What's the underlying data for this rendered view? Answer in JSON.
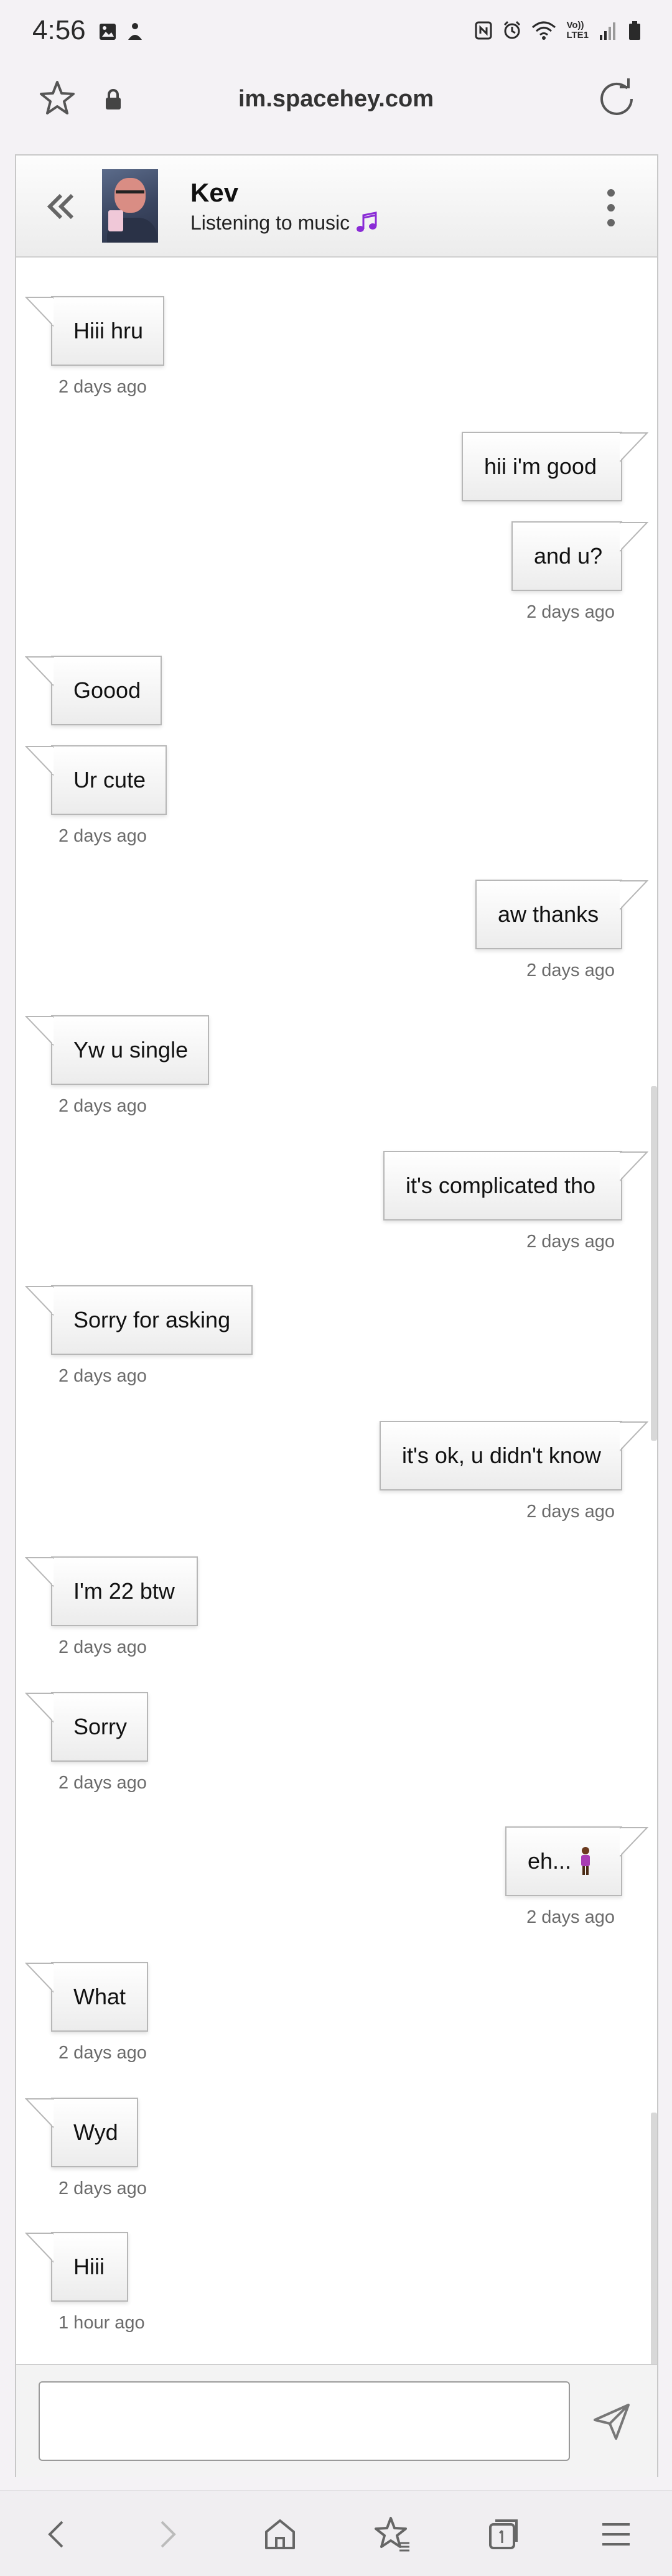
{
  "status_bar": {
    "time": "4:56",
    "network_label_top": "Vo))",
    "network_label_bottom": "LTE1"
  },
  "browser": {
    "url": "im.spacehey.com"
  },
  "chat": {
    "contact_name": "Kev",
    "contact_status": "Listening to music",
    "composer_placeholder": ""
  },
  "messages": [
    {
      "side": "in",
      "text": "Hiii hru",
      "time": "2 days ago"
    },
    {
      "side": "out",
      "text": "hii i'm good",
      "time": ""
    },
    {
      "side": "out",
      "text": "and u?",
      "time": "2 days ago"
    },
    {
      "side": "in",
      "text": "Goood",
      "time": ""
    },
    {
      "side": "in",
      "text": "Ur cute",
      "time": "2 days ago"
    },
    {
      "side": "out",
      "text": "aw thanks",
      "time": "2 days ago"
    },
    {
      "side": "in",
      "text": "Yw u single",
      "time": "2 days ago"
    },
    {
      "side": "out",
      "text": "it's complicated tho",
      "time": "2 days ago"
    },
    {
      "side": "in",
      "text": "Sorry for asking",
      "time": "2 days ago"
    },
    {
      "side": "out",
      "text": "it's ok, u didn't know",
      "time": "2 days ago"
    },
    {
      "side": "in",
      "text": "I'm 22 btw",
      "time": "2 days ago"
    },
    {
      "side": "in",
      "text": "Sorry",
      "time": "2 days ago"
    },
    {
      "side": "out",
      "text": "eh...",
      "time": "2 days ago",
      "emoji": "person-standing-emoji"
    },
    {
      "side": "in",
      "text": "What",
      "time": "2 days ago"
    },
    {
      "side": "in",
      "text": "Wyd",
      "time": "2 days ago"
    },
    {
      "side": "in",
      "text": "Hiii",
      "time": "1 hour ago"
    }
  ],
  "colors": {
    "music_icon": "#8a2bd6",
    "time_text": "#6b6b6b",
    "bubble_border": "#b7b7b7"
  }
}
